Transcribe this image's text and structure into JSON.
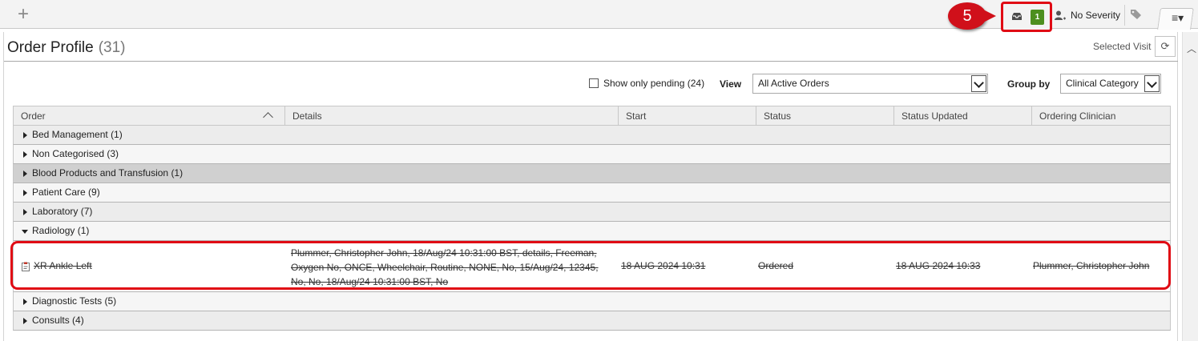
{
  "toolbar": {
    "add_symbol": "+",
    "callout_number": "5",
    "inbox_count": "1",
    "severity_label": "No Severity",
    "menu_symbol": "≡▾"
  },
  "header": {
    "title": "Order Profile",
    "count": "(31)",
    "selected_visit": "Selected Visit"
  },
  "filters": {
    "pending_label": "Show only pending (24)",
    "pending_checked": false,
    "view_label": "View",
    "view_value": "All Active Orders",
    "group_label": "Group by",
    "group_value": "Clinical Category"
  },
  "table": {
    "columns": [
      "Order",
      "Details",
      "Start",
      "Status",
      "Status Updated",
      "Ordering Clinician"
    ],
    "groups_before": [
      {
        "label": "Bed Management (1)"
      },
      {
        "label": "Non Categorised (3)"
      },
      {
        "label": "Blood Products and Transfusion (1)"
      },
      {
        "label": "Patient Care (9)"
      },
      {
        "label": "Laboratory (7)"
      },
      {
        "label": "Radiology (1)"
      }
    ],
    "order": {
      "name": "XR Ankle Left",
      "details": "Plummer, Christopher John, 18/Aug/24 10:31:00 BST, details, Freeman, Oxygen No, ONCE, Wheelchair, Routine, NONE, No, 15/Aug/24, 12345, No, No, 18/Aug/24 10:31:00 BST, No",
      "start": "18 AUG 2024 10:31",
      "status": "Ordered",
      "status_updated": "18 AUG 2024 10:33",
      "clinician": "Plummer, Christopher John"
    },
    "groups_after": [
      {
        "label": "Diagnostic Tests (5)"
      },
      {
        "label": "Consults (4)"
      }
    ]
  },
  "colors": {
    "callout_red": "#d0101a",
    "highlight_red": "#e00a14",
    "badge_green": "#4d8f1f"
  },
  "icons": [
    "plus-icon",
    "inbox-icon",
    "person-icon",
    "tag-icon",
    "menu-icon",
    "refresh-icon",
    "order-document-icon",
    "sort-up-icon",
    "dropdown-caret-icon",
    "expand-triangle-icon"
  ]
}
